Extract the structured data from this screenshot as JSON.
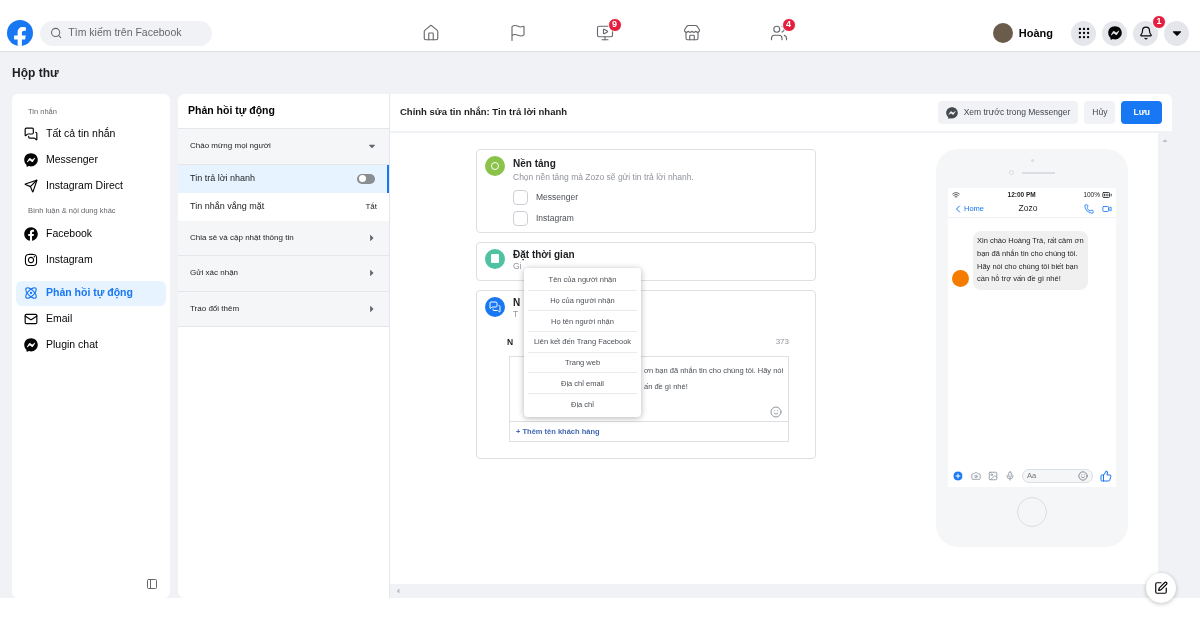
{
  "nav": {
    "search": {
      "placeholder": "Tìm kiếm trên Facebook"
    },
    "tabs": [
      {
        "kind": "home"
      },
      {
        "kind": "pages"
      },
      {
        "kind": "watch",
        "badge": "9"
      },
      {
        "kind": "marketplace"
      },
      {
        "kind": "groups",
        "badge": "4"
      }
    ],
    "profile": {
      "name": "Hoàng"
    },
    "actions": [
      {
        "kind": "menu"
      },
      {
        "kind": "messenger"
      },
      {
        "kind": "notifications",
        "badge": "1"
      },
      {
        "kind": "account"
      }
    ]
  },
  "page_title": "Hộp thư",
  "sidebar": {
    "sections": [
      {
        "heading": "Tin nhắn",
        "items": [
          {
            "label": "Tất cả tin nhắn",
            "selected": false
          },
          {
            "label": "Messenger",
            "selected": false
          },
          {
            "label": "Instagram Direct",
            "selected": false
          }
        ]
      },
      {
        "heading": "Bình luận & nội dung khác",
        "items": [
          {
            "label": "Facebook",
            "selected": false
          },
          {
            "label": "Instagram",
            "selected": false
          },
          {
            "label": "Phản hồi tự động",
            "selected": true
          },
          {
            "label": "Email",
            "selected": false
          },
          {
            "label": "Plugin chat",
            "selected": false
          }
        ]
      }
    ]
  },
  "settings_panel": {
    "title": "Phản hồi tự động",
    "groups": [
      {
        "label": "Chào mừng mọi người",
        "expanded": true,
        "items": [
          {
            "label": "Tin trả lời nhanh",
            "selected": true,
            "kind": "toggle",
            "on": false
          },
          {
            "label": "Tin nhắn vắng mặt",
            "selected": false,
            "kind": "status",
            "status": "Tắt"
          }
        ]
      },
      {
        "label": "Chia sẻ và cập nhật thông tin",
        "expanded": false
      },
      {
        "label": "Gửi xác nhận",
        "expanded": false
      },
      {
        "label": "Trao đổi thêm",
        "expanded": false
      }
    ]
  },
  "editor": {
    "title": "Chỉnh sửa tin nhắn: Tin trả lời nhanh",
    "buttons": [
      {
        "label": "Xem trước trong Messenger",
        "kind": "preview"
      },
      {
        "label": "Hủy",
        "kind": "secondary"
      },
      {
        "label": "Lưu",
        "kind": "primary"
      }
    ],
    "cards": [
      {
        "kind": "platform",
        "title": "Nền tảng",
        "subtitle": "Chọn nền tảng mà Zozo sẽ gửi tin trả lời nhanh.",
        "options": [
          {
            "label": "Messenger",
            "checked": false
          },
          {
            "label": "Instagram",
            "checked": false
          }
        ]
      },
      {
        "kind": "schedule",
        "title": "Đặt thời gian",
        "subtitle": "Gi"
      },
      {
        "kind": "message",
        "title": "N",
        "subtitle": "T",
        "field_label": "N",
        "count": "373",
        "text_lines": [
          "ơn bạn đã nhắn tin cho chúng tôi. Hãy nói",
          "ấn đề gì nhé!"
        ],
        "add_link": "+ Thêm tên khách hàng"
      }
    ],
    "menu": {
      "items": [
        "Tên của người nhận",
        "Họ của người nhận",
        "Họ tên người nhận",
        "Liên kết đến Trang Facebook",
        "Trang web",
        "Địa chỉ email",
        "Địa chỉ"
      ]
    }
  },
  "preview": {
    "status_time": "12:00 PM",
    "battery": "100%",
    "back": "Home",
    "contact": "Zozo",
    "message": "Xin chào Hoàng Trà, rất cảm ơn bạn đã nhắn tin cho chúng tôi. Hãy nói cho chúng tôi biết bạn cần hỗ trợ vấn đề gì nhé!",
    "input_placeholder": "Aa"
  }
}
